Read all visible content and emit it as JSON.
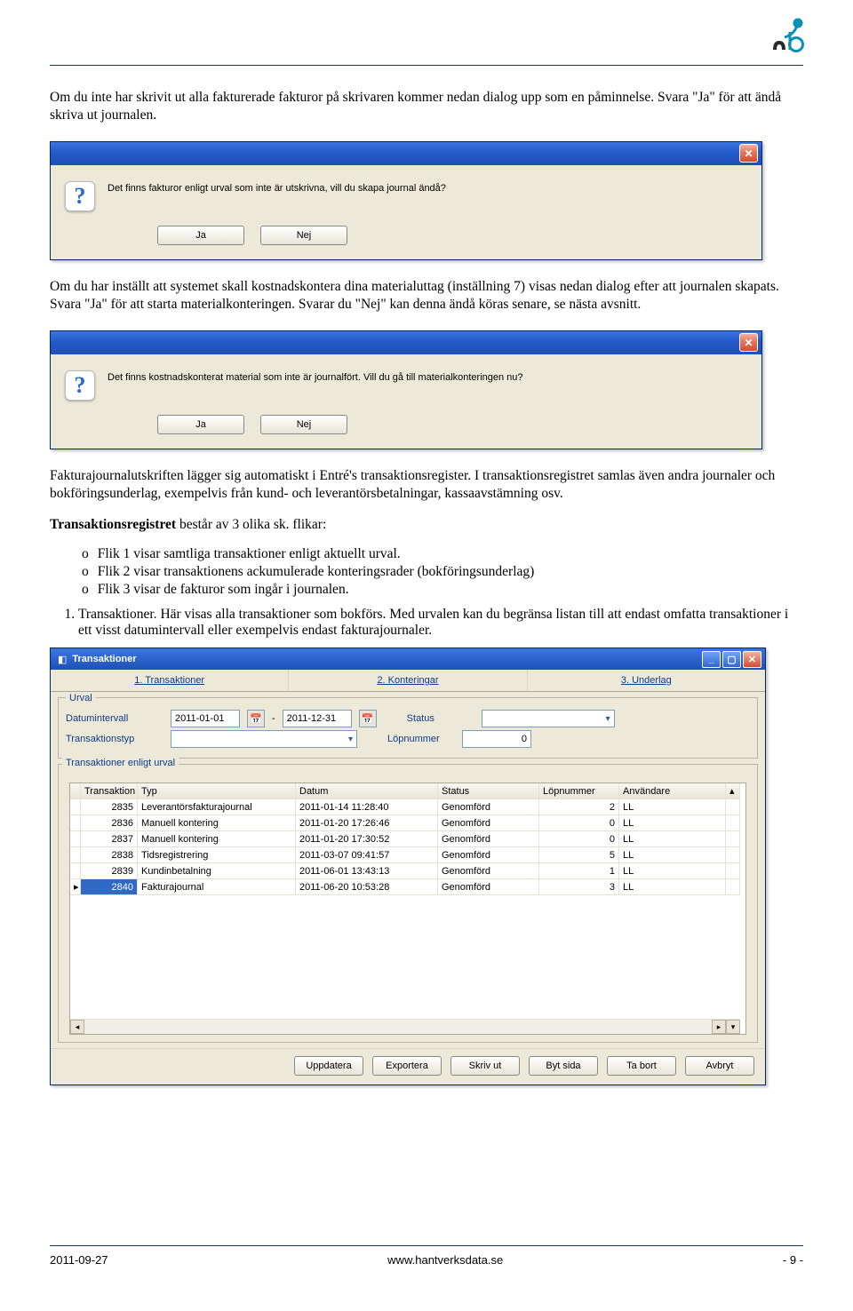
{
  "para1": "Om du inte har skrivit ut alla fakturerade fakturor på skrivaren kommer nedan dialog upp som en påminnelse. Svara \"Ja\" för att ändå skriva ut journalen.",
  "dialog1": {
    "text": "Det finns fakturor enligt urval som inte är utskrivna, vill du skapa journal ändå?",
    "yes": "Ja",
    "no": "Nej"
  },
  "para2": "Om du har inställt att systemet skall kostnadskontera dina materialuttag (inställning 7) visas nedan dialog efter att journalen skapats. Svara \"Ja\" för att starta materialkonteringen. Svarar du \"Nej\" kan denna ändå köras senare, se nästa avsnitt.",
  "dialog2": {
    "text": "Det finns kostnadskonterat material som inte är journalfört. Vill du gå till materialkonteringen nu?",
    "yes": "Ja",
    "no": "Nej"
  },
  "para3": "Fakturajournalutskriften lägger sig automatiskt i Entré's transaktionsregister. I transaktionsregistret samlas även andra journaler och bokföringsunderlag, exempelvis från kund- och leverantörsbetalningar, kassaavstämning osv.",
  "trans_intro_bold": "Transaktionsregistret",
  "trans_intro_rest": " består av 3 olika sk. flikar:",
  "bullets": {
    "b1": "Flik 1 visar samtliga transaktioner enligt aktuellt urval.",
    "b2": "Flik 2 visar transaktionens ackumulerade konteringsrader (bokföringsunderlag)",
    "b3": "Flik 3 visar de fakturor som ingår i journalen."
  },
  "num1_lead": "Transaktioner. ",
  "num1_rest": "Här visas alla transaktioner som bokförs. Med urvalen kan du begränsa listan till att endast omfatta transaktioner i ett visst datumintervall eller exempelvis endast fakturajournaler.",
  "win": {
    "title": "Transaktioner",
    "tabs": {
      "t1": "1. Transaktioner",
      "t2": "2. Konteringar",
      "t3": "3. Underlag"
    },
    "urval_legend": "Urval",
    "labels": {
      "datum": "Datumintervall",
      "status": "Status",
      "typ": "Transaktionstyp",
      "lopnr": "Löpnummer"
    },
    "values": {
      "d1": "2011-01-01",
      "d2": "2011-12-31",
      "lopnr": "0"
    },
    "table_legend": "Transaktioner enligt urval",
    "cols": {
      "c1": "Transaktion",
      "c2": "Typ",
      "c3": "Datum",
      "c4": "Status",
      "c5": "Löpnummer",
      "c6": "Användare"
    },
    "rows": [
      {
        "id": "2835",
        "typ": "Leverantörsfakturajournal",
        "datum": "2011-01-14 11:28:40",
        "status": "Genomförd",
        "lop": "2",
        "user": "LL"
      },
      {
        "id": "2836",
        "typ": "Manuell kontering",
        "datum": "2011-01-20 17:26:46",
        "status": "Genomförd",
        "lop": "0",
        "user": "LL"
      },
      {
        "id": "2837",
        "typ": "Manuell kontering",
        "datum": "2011-01-20 17:30:52",
        "status": "Genomförd",
        "lop": "0",
        "user": "LL"
      },
      {
        "id": "2838",
        "typ": "Tidsregistrering",
        "datum": "2011-03-07 09:41:57",
        "status": "Genomförd",
        "lop": "5",
        "user": "LL"
      },
      {
        "id": "2839",
        "typ": "Kundinbetalning",
        "datum": "2011-06-01 13:43:13",
        "status": "Genomförd",
        "lop": "1",
        "user": "LL"
      },
      {
        "id": "2840",
        "typ": "Fakturajournal",
        "datum": "2011-06-20 10:53:28",
        "status": "Genomförd",
        "lop": "3",
        "user": "LL"
      }
    ],
    "buttons": {
      "upd": "Uppdatera",
      "exp": "Exportera",
      "prn": "Skriv ut",
      "byt": "Byt sida",
      "del": "Ta bort",
      "avb": "Avbryt"
    }
  },
  "footer": {
    "left": "2011-09-27",
    "mid": "www.hantverksdata.se",
    "right": "- 9 -"
  }
}
